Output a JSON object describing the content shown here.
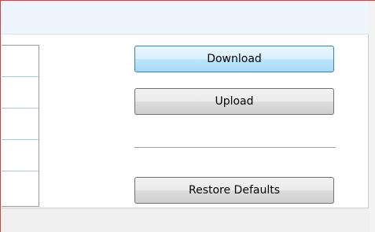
{
  "buttons": {
    "download_label": "Download",
    "upload_label": "Upload",
    "restore_defaults_label": "Restore Defaults"
  },
  "colors": {
    "window_border": "#e53a3a",
    "header_strip": "#eef5fd",
    "hover_button": "#bee6fd",
    "row_divider": "#a9c9e8"
  }
}
